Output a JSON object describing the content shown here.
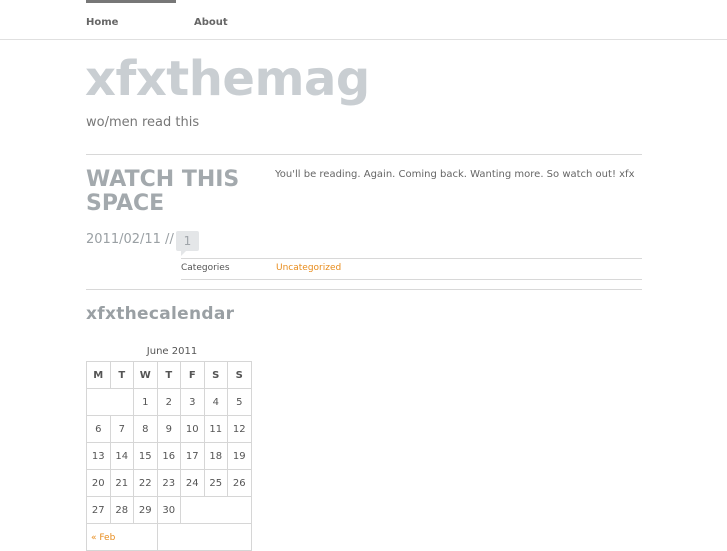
{
  "nav": {
    "items": [
      {
        "label": "Home"
      },
      {
        "label": "About"
      }
    ]
  },
  "site": {
    "title": "xfxthemag",
    "tagline": "wo/men read this"
  },
  "post": {
    "title": "WATCH THIS SPACE",
    "excerpt": "You'll be reading. Again. Coming back. Wanting more. So watch out! xfx",
    "date": "2011/02/11 //",
    "comment_count": "1",
    "categories_label": "Categories",
    "category": "Uncategorized"
  },
  "calendar": {
    "widget_title": "xfxthecalendar",
    "caption": "June 2011",
    "weekdays": [
      "M",
      "T",
      "W",
      "T",
      "F",
      "S",
      "S"
    ],
    "weeks": [
      [
        "",
        "",
        "1",
        "2",
        "3",
        "4",
        "5"
      ],
      [
        "6",
        "7",
        "8",
        "9",
        "10",
        "11",
        "12"
      ],
      [
        "13",
        "14",
        "15",
        "16",
        "17",
        "18",
        "19"
      ],
      [
        "20",
        "21",
        "22",
        "23",
        "24",
        "25",
        "26"
      ],
      [
        "27",
        "28",
        "29",
        "30",
        "",
        "",
        ""
      ]
    ],
    "prev_link": "« Feb"
  },
  "colors": {
    "accent": "#e88c1c",
    "title_gray": "#c9ced2"
  }
}
